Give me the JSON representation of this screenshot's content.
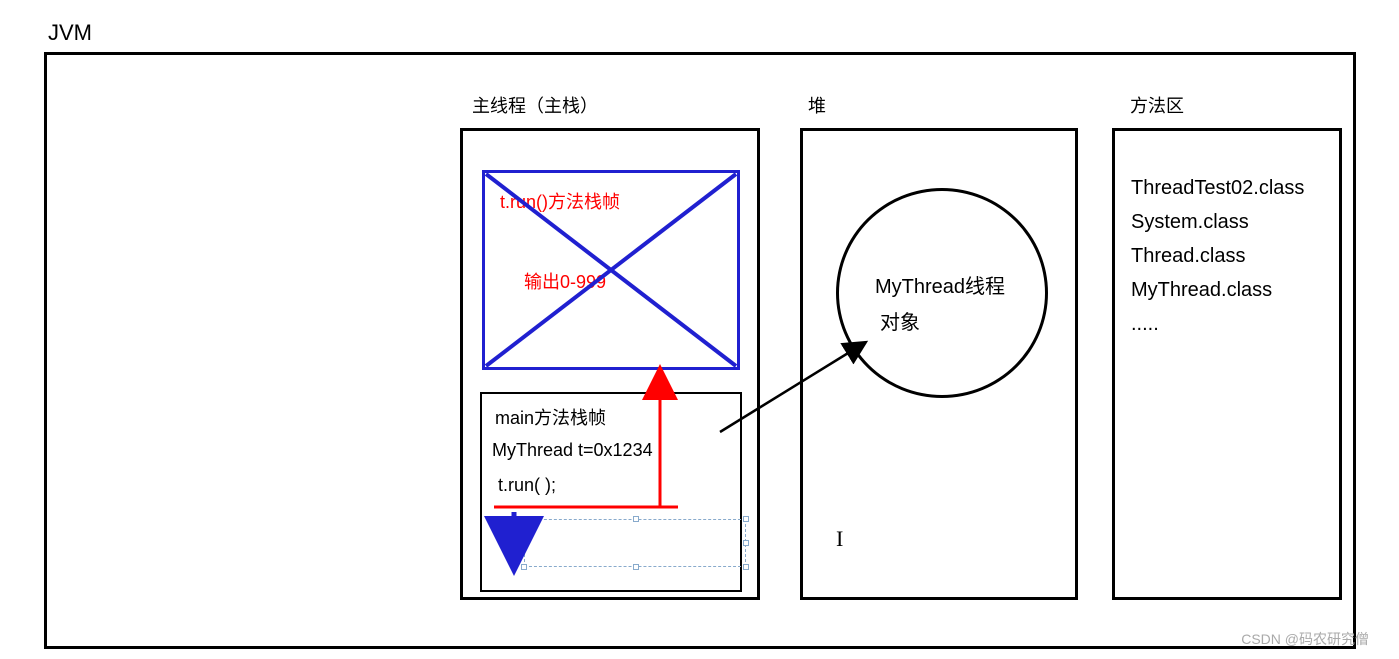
{
  "title": "JVM",
  "sections": {
    "stack_label": "主线程（主栈）",
    "heap_label": "堆",
    "method_label": "方法区"
  },
  "run_frame": {
    "title": "t.run()方法栈帧",
    "body": "输出0-999"
  },
  "main_frame": {
    "line1": "main方法栈帧",
    "line2": "MyThread  t=0x1234",
    "line3": "t.run( );"
  },
  "heap": {
    "object_line1": "MyThread线程",
    "object_line2": "对象"
  },
  "method_area": {
    "c1": "ThreadTest02.class",
    "c2": "System.class",
    "c3": "Thread.class",
    "c4": "MyThread.class",
    "more": "....."
  },
  "watermark": "CSDN @码农研究僧"
}
